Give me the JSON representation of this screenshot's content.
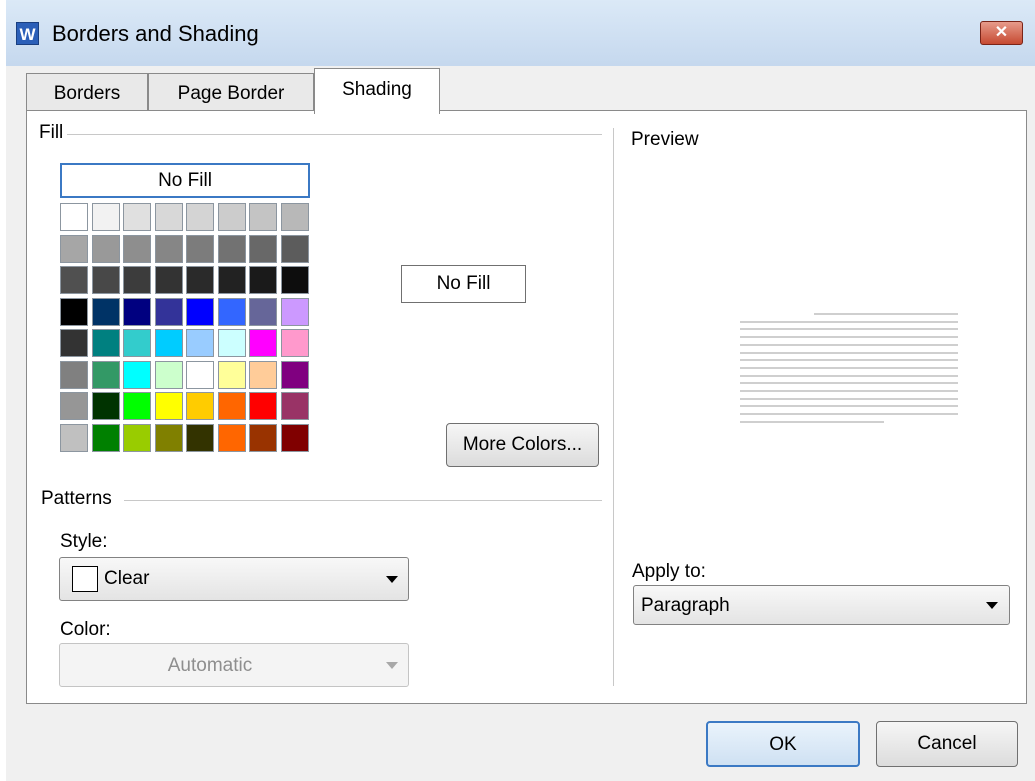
{
  "window": {
    "title": "Borders and Shading",
    "app_icon": "W"
  },
  "tabs": [
    {
      "label": "Borders"
    },
    {
      "label": "Page Border"
    },
    {
      "label": "Shading"
    }
  ],
  "fill": {
    "label": "Fill",
    "no_fill_label": "No Fill",
    "current_fill_label": "No Fill",
    "more_colors_label": "More Colors...",
    "palette": [
      [
        "#ffffff",
        "#f2f2f2",
        "#e0e0e0",
        "#d8d8d8",
        "#d4d4d4",
        "#cccccc",
        "#c4c4c4",
        "#b8b8b8"
      ],
      [
        "#a6a6a6",
        "#999999",
        "#8e8e8e",
        "#868686",
        "#7c7c7c",
        "#727272",
        "#686868",
        "#5c5c5c"
      ],
      [
        "#505050",
        "#484848",
        "#3c3c3c",
        "#333333",
        "#2a2a2a",
        "#222222",
        "#1a1a1a",
        "#0d0d0d"
      ],
      [
        "#000000",
        "#003366",
        "#000080",
        "#333399",
        "#0000ff",
        "#3366ff",
        "#666699",
        "#cc99ff"
      ],
      [
        "#333333",
        "#008080",
        "#33cccc",
        "#00ccff",
        "#99ccff",
        "#ccffff",
        "#ff00ff",
        "#ff99cc"
      ],
      [
        "#808080",
        "#339966",
        "#00ffff",
        "#ccffcc",
        "#ffffff",
        "#ffff99",
        "#ffcc99",
        "#800080"
      ],
      [
        "#969696",
        "#003300",
        "#00ff00",
        "#ffff00",
        "#ffcc00",
        "#ff6600",
        "#ff0000",
        "#993366"
      ],
      [
        "#c0c0c0",
        "#008000",
        "#99cc00",
        "#808000",
        "#333300",
        "#ff6600",
        "#993300",
        "#800000"
      ]
    ]
  },
  "patterns": {
    "label": "Patterns",
    "style_label": "Style:",
    "style_value": "Clear",
    "color_label": "Color:",
    "color_value": "Automatic"
  },
  "preview": {
    "label": "Preview"
  },
  "apply_to": {
    "label": "Apply to:",
    "value": "Paragraph"
  },
  "buttons": {
    "ok": "OK",
    "cancel": "Cancel"
  }
}
